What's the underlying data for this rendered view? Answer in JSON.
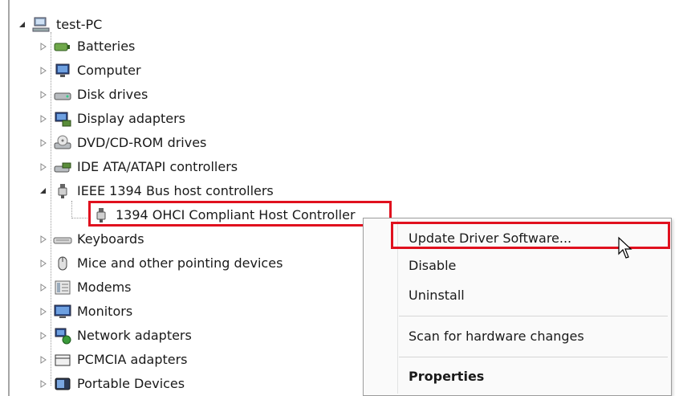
{
  "tree": {
    "root": "test-PC",
    "items": [
      {
        "label": "Batteries",
        "icon": "battery-icon"
      },
      {
        "label": "Computer",
        "icon": "computer-icon"
      },
      {
        "label": "Disk drives",
        "icon": "disk-drive-icon"
      },
      {
        "label": "Display adapters",
        "icon": "display-adapter-icon"
      },
      {
        "label": "DVD/CD-ROM drives",
        "icon": "dvd-drive-icon"
      },
      {
        "label": "IDE ATA/ATAPI controllers",
        "icon": "ide-controller-icon"
      },
      {
        "label": "IEEE 1394 Bus host controllers",
        "icon": "ieee1394-icon"
      },
      {
        "label": "Keyboards",
        "icon": "keyboard-icon"
      },
      {
        "label": "Mice and other pointing devices",
        "icon": "mouse-icon"
      },
      {
        "label": "Modems",
        "icon": "modem-icon"
      },
      {
        "label": "Monitors",
        "icon": "monitor-icon"
      },
      {
        "label": "Network adapters",
        "icon": "network-adapter-icon"
      },
      {
        "label": "PCMCIA adapters",
        "icon": "pcmcia-icon"
      },
      {
        "label": "Portable Devices",
        "icon": "portable-device-icon"
      }
    ],
    "child": "1394 OHCI Compliant Host Controller"
  },
  "context_menu": {
    "update": "Update Driver Software...",
    "disable": "Disable",
    "uninstall": "Uninstall",
    "scan": "Scan for hardware changes",
    "properties": "Properties"
  },
  "colors": {
    "highlight_border": "#e0101e"
  }
}
